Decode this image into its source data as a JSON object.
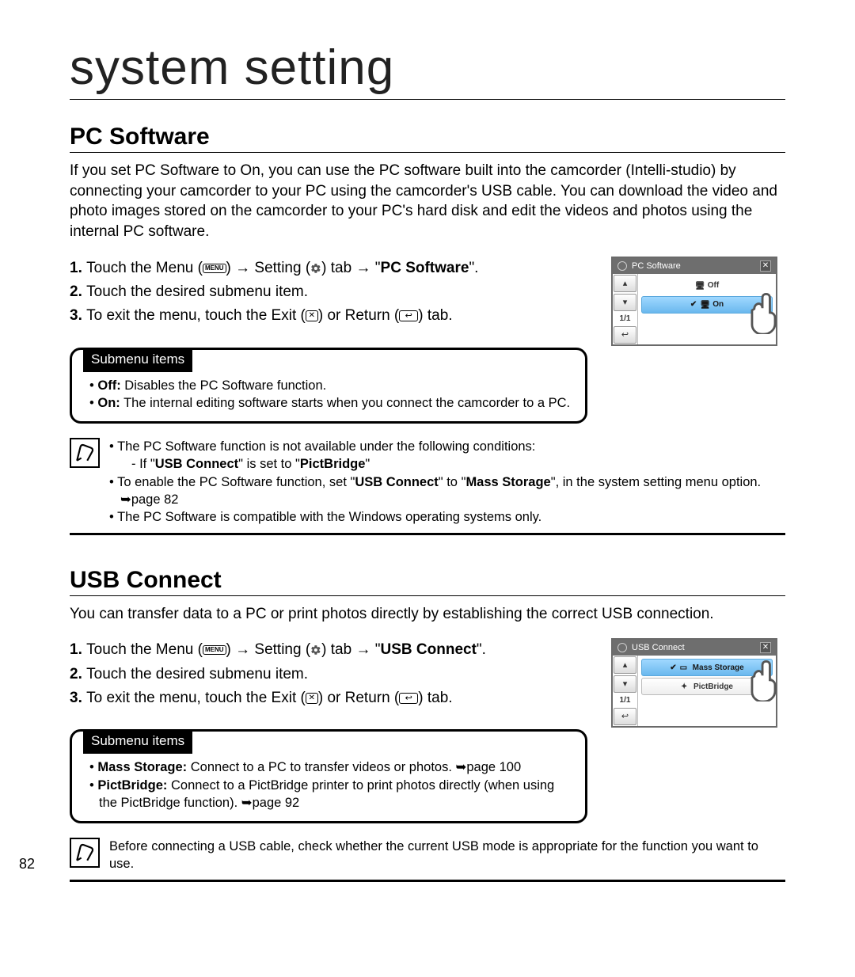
{
  "chapter": "system setting",
  "page_number": "82",
  "pc_software": {
    "heading": "PC Software",
    "intro": "If you set PC Software to On, you can use the PC software built into the camcorder (Intelli-studio) by connecting your camcorder to your PC using the camcorder's USB cable. You can download the video and photo images stored on the camcorder to your PC's hard disk and edit the videos and photos using the internal PC software.",
    "steps": {
      "s1_a": "Touch the Menu (",
      "s1_b": ") ",
      "s1_c": " Setting (",
      "s1_d": ") tab ",
      "s1_e": " \"",
      "s1_target": "PC Software",
      "s1_f": "\".",
      "s2": "Touch the desired submenu item.",
      "s3_a": "To exit the menu, touch the Exit (",
      "s3_b": ") or Return (",
      "s3_c": ") tab."
    },
    "submenu_label": "Submenu items",
    "submenu": {
      "off_label": "Off:",
      "off_text": " Disables the PC Software function.",
      "on_label": "On:",
      "on_text": " The internal editing software starts when you connect the camcorder to a PC."
    },
    "note": {
      "n1": "The PC Software function is not available under the following conditions:",
      "n1a_a": "If \"",
      "n1a_b": "USB Connect",
      "n1a_c": "\" is set to \"",
      "n1a_d": "PictBridge",
      "n1a_e": "\"",
      "n2_a": "To enable the PC Software function, set \"",
      "n2_b": "USB Connect",
      "n2_c": "\" to \"",
      "n2_d": "Mass Storage",
      "n2_e": "\", in the system setting menu option. ➥page 82",
      "n3": "The PC Software is compatible with the Windows operating systems only."
    },
    "screen": {
      "title": "PC Software",
      "opt_off": "Off",
      "opt_on": "On",
      "page": "1/1"
    }
  },
  "usb_connect": {
    "heading": "USB Connect",
    "intro": "You can transfer data to a PC or print photos directly by establishing the correct USB connection.",
    "steps": {
      "s1_a": "Touch the Menu (",
      "s1_b": ") ",
      "s1_c": " Setting (",
      "s1_d": ") tab ",
      "s1_e": " \"",
      "s1_target": "USB Connect",
      "s1_f": "\".",
      "s2": "Touch the desired submenu item.",
      "s3_a": "To exit the menu, touch the Exit (",
      "s3_b": ") or Return (",
      "s3_c": ") tab."
    },
    "submenu_label": "Submenu items",
    "submenu": {
      "ms_label": "Mass Storage:",
      "ms_text": " Connect to a PC to transfer videos or photos. ➥page 100",
      "pb_label": "PictBridge:",
      "pb_text": " Connect to a PictBridge printer to print photos directly (when using the PictBridge function). ➥page 92"
    },
    "note": "Before connecting a USB cable, check whether the current USB mode is appropriate for the function you want to use.",
    "screen": {
      "title": "USB Connect",
      "opt_ms": "Mass Storage",
      "opt_pb": "PictBridge",
      "page": "1/1"
    }
  },
  "icons": {
    "menu": "MENU",
    "arrow": "→",
    "x": "✕",
    "return": "↩",
    "check": "✔"
  }
}
